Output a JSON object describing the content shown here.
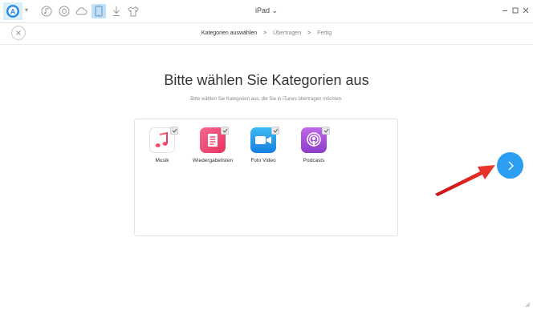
{
  "window": {
    "title": "iPad",
    "title_caret": "⌄",
    "logo_letter": "A"
  },
  "toolbar": {
    "icons": [
      "music-note-icon",
      "cd-icon",
      "cloud-icon",
      "tablet-icon",
      "download-icon",
      "tshirt-icon"
    ],
    "active": "tablet-icon"
  },
  "steps": {
    "current": "Kategorien auswählen",
    "step2": "Übertragen",
    "step3": "Fertig",
    "separator": ">"
  },
  "main": {
    "heading": "Bitte wählen Sie Kategorien aus",
    "subheading": "Bitte wählen Sie Kategorien aus, die Sie in iTunes übertragen möchten."
  },
  "categories": [
    {
      "label": "Musik",
      "icon": "music-icon",
      "checked": true
    },
    {
      "label": "Wiedergabelisten",
      "icon": "playlist-icon",
      "checked": true
    },
    {
      "label": "Foto Video",
      "icon": "video-camera-icon",
      "checked": true
    },
    {
      "label": "Podcasts",
      "icon": "podcast-icon",
      "checked": true
    }
  ],
  "colors": {
    "accent": "#2b9ef2",
    "arrow": "#e8191e",
    "music_pink": "#f23b5c",
    "playlist_pink": "#f0467e",
    "video_blue": "#1ea1f2",
    "podcast_purple": "#a54fd6"
  }
}
